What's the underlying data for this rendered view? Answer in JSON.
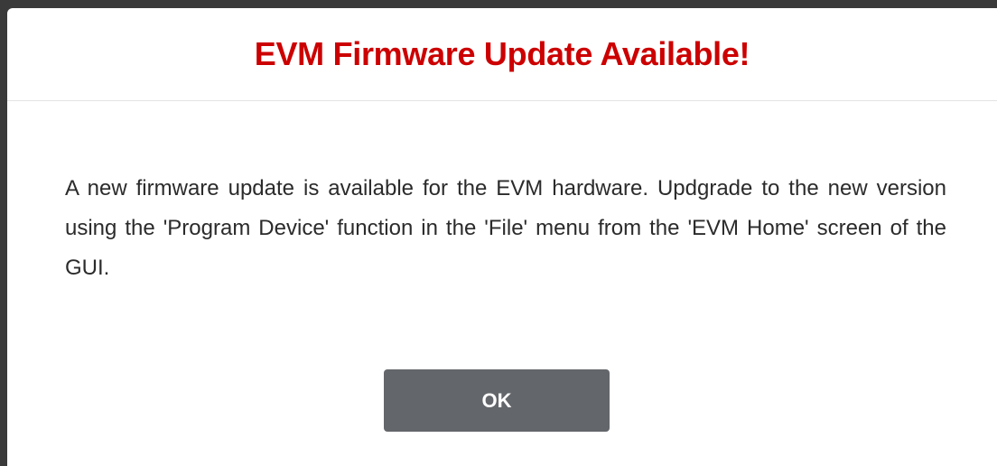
{
  "dialog": {
    "title": "EVM Firmware Update Available!",
    "message": "A new firmware update is available for the EVM hardware. Updgrade to the new version using the 'Program Device' function in the 'File' menu from the 'EVM Home' screen of the GUI.",
    "ok_label": "OK"
  },
  "colors": {
    "title": "#cc0000",
    "button_bg": "#63666a",
    "button_text": "#ffffff",
    "backdrop": "#3a3a3a"
  }
}
